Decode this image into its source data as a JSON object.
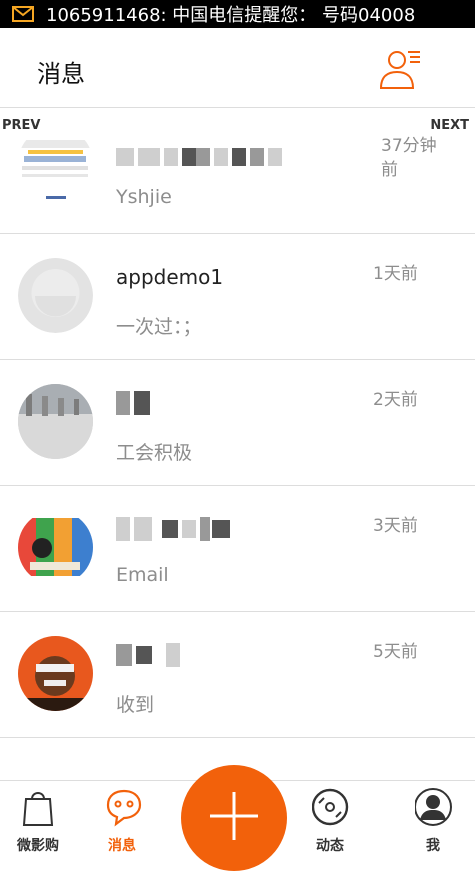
{
  "status_bar": {
    "notification_text": "1065911468: 中国电信提醒您： 号码04008"
  },
  "header": {
    "title": "消息",
    "contacts_icon": "contacts-icon"
  },
  "pager": {
    "prev": "PREV",
    "next": "NEXT"
  },
  "conversations": [
    {
      "name": "",
      "preview": "Yshjie",
      "time": "37分钟前"
    },
    {
      "name": "appdemo1",
      "preview": "一次过：；",
      "time": "1天前"
    },
    {
      "name": "",
      "preview": "工会积极",
      "time": "2天前"
    },
    {
      "name": "",
      "preview": "Email",
      "time": "3天前"
    },
    {
      "name": "",
      "preview": "收到",
      "time": "5天前"
    }
  ],
  "bottom_nav": {
    "tabs": [
      {
        "label": "微影购",
        "icon": "shopping-bag-icon"
      },
      {
        "label": "消息",
        "icon": "chat-bubble-icon"
      },
      {
        "label": "动态",
        "icon": "disc-icon"
      },
      {
        "label": "我",
        "icon": "profile-icon"
      }
    ],
    "active_tab": "消息",
    "compose_icon": "plus-icon"
  },
  "colors": {
    "accent": "#f2610b",
    "status_bar": "#000000",
    "divider": "#dddddd",
    "secondary_text": "#8d8d8d"
  }
}
